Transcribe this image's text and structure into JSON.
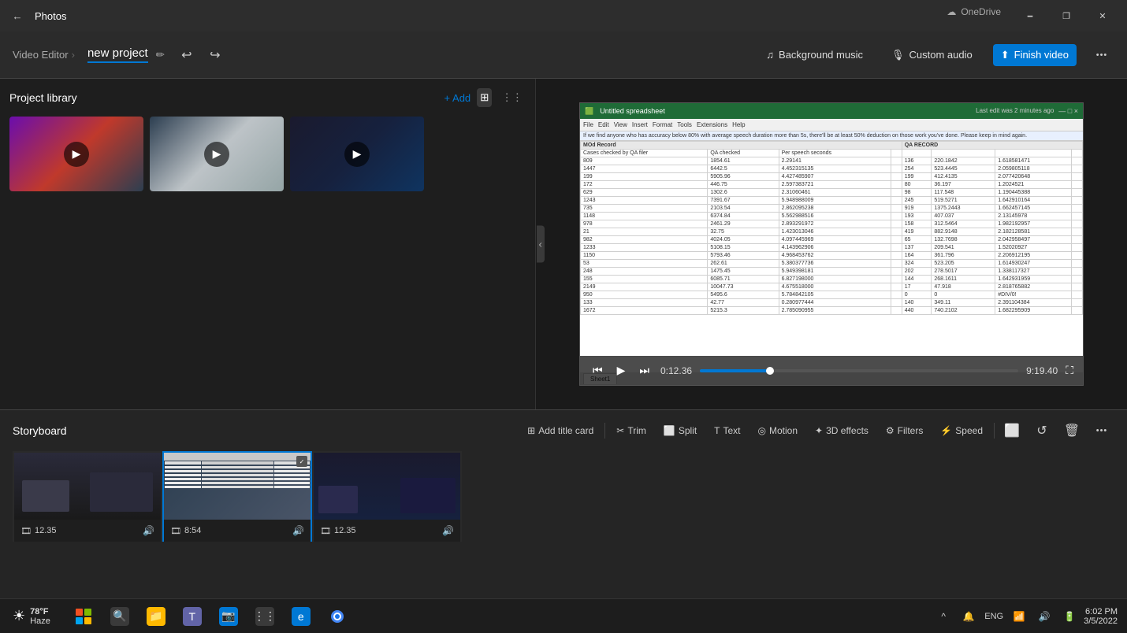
{
  "titlebar": {
    "app_name": "Photos",
    "back_label": "←",
    "onedrive_label": "OneDrive",
    "minimize": "🗕",
    "restore": "❐",
    "close": "✕"
  },
  "toolbar": {
    "breadcrumb_separator": "›",
    "video_editor_label": "Video Editor",
    "project_title": "new project",
    "edit_icon": "✏",
    "undo_icon": "↩",
    "redo_icon": "↪",
    "background_music_label": "Background music",
    "custom_audio_label": "Custom audio",
    "finish_video_label": "Finish video",
    "more_icon": "•••"
  },
  "project_library": {
    "title": "Project library",
    "add_label": "+ Add",
    "grid_view_label": "⊞",
    "list_view_label": "⋮⋮",
    "media_items": [
      {
        "type": "video",
        "id": 1
      },
      {
        "type": "video",
        "id": 2
      },
      {
        "type": "video",
        "id": 3
      }
    ]
  },
  "video_player": {
    "current_time": "0:12.36",
    "total_time": "9:19.40",
    "rewind_icon": "⏮",
    "play_icon": "▶",
    "forward_icon": "⏭",
    "fullscreen_icon": "⛶",
    "progress_percent": 22
  },
  "storyboard": {
    "title": "Storyboard",
    "tools": [
      {
        "id": "add-title",
        "label": "Add title card",
        "icon": "⊞"
      },
      {
        "id": "trim",
        "label": "Trim",
        "icon": "✂"
      },
      {
        "id": "split",
        "label": "Split",
        "icon": "⬜"
      },
      {
        "id": "text",
        "label": "Text",
        "icon": "T"
      },
      {
        "id": "motion",
        "label": "Motion",
        "icon": "◎"
      },
      {
        "id": "3d-effects",
        "label": "3D effects",
        "icon": "✦"
      },
      {
        "id": "filters",
        "label": "Filters",
        "icon": "⚙"
      },
      {
        "id": "speed",
        "label": "Speed",
        "icon": "⚡"
      }
    ],
    "clips": [
      {
        "id": 1,
        "duration": "12.35",
        "has_audio": true
      },
      {
        "id": 2,
        "duration": "8:54",
        "has_audio": true,
        "selected": true
      },
      {
        "id": 3,
        "duration": "12.35",
        "has_audio": true
      }
    ]
  },
  "taskbar": {
    "weather": {
      "icon": "☀",
      "temp": "78°F",
      "condition": "Haze"
    },
    "clock": {
      "time": "6:02 PM",
      "date": "3/5/2022"
    },
    "language": "ENG",
    "tray_icons": [
      "^",
      "🔔",
      "⌨",
      "🔊",
      "📶",
      "🔋"
    ]
  },
  "spreadsheet": {
    "title": "Untitled spreadsheet",
    "menu_items": [
      "File",
      "Edit",
      "View",
      "Insert",
      "Format",
      "Tools",
      "Extensions",
      "Help"
    ],
    "last_edit": "Last edit was 2 minutes ago",
    "tab_name": "Sheet1",
    "headers": [
      "MOd Record",
      "",
      "",
      "",
      "QA RECORD"
    ],
    "sub_headers": [
      "Cases checked by QA filer",
      "QA checked",
      "Per speech seconds",
      "",
      "",
      "",
      ""
    ],
    "rows": [
      [
        "809",
        "1854.61",
        "2.29141",
        "136",
        "220.1842",
        "1.618581471"
      ],
      [
        "1447",
        "6442.5",
        "4.452315135",
        "254",
        "523.4445",
        "2.059805118"
      ],
      [
        "199",
        "5905.96",
        "4.427485907",
        "199",
        "412.4135",
        "2.077420648"
      ],
      [
        "172",
        "446.75",
        "2.597383721",
        "80",
        "36.197",
        "1.2024521"
      ],
      [
        "629",
        "1302.6",
        "2.31060461",
        "98",
        "117.548",
        "1.190445388"
      ],
      [
        "1243",
        "7391.67",
        "5.948988009",
        "245",
        "519.5271",
        "1.642910164"
      ],
      [
        "735",
        "2103.54",
        "2.862095238",
        "919",
        "1375.2443",
        "1.662457145"
      ],
      [
        "1148",
        "6374.84",
        "5.562988516",
        "193",
        "407.037",
        "2.13145978"
      ],
      [
        "978",
        "2461.29",
        "2.893291972",
        "158",
        "312.5464",
        "1.982192957"
      ],
      [
        "21",
        "32.75",
        "1.423013046",
        "419",
        "882.9148",
        "2.182128581"
      ],
      [
        "982",
        "4024.05",
        "4.097445969",
        "65",
        "132.7698",
        "2.042958497"
      ],
      [
        "1233",
        "5108.15",
        "4.143962906",
        "137",
        "209.541",
        "1.52020927"
      ],
      [
        "1150",
        "5793.46",
        "4.968453762",
        "164",
        "361.796",
        "2.206912195"
      ],
      [
        "53",
        "262.61",
        "5.380377736",
        "324",
        "523.205",
        "1.614930247"
      ],
      [
        "248",
        "1475.45",
        "5.949398181",
        "202",
        "278.5017",
        "1.338117327"
      ],
      [
        "155",
        "6085.71",
        "6.827198000",
        "144",
        "268.1611",
        "1.642931959"
      ],
      [
        "2149",
        "10047.73",
        "4.675518000",
        "17",
        "47.918",
        "2.818765882"
      ],
      [
        "950",
        "5495.6",
        "5.784842105",
        "0",
        "0",
        "#DIV/0!"
      ],
      [
        "133",
        "42.77",
        "0.280977444",
        "140",
        "349.11",
        "2.391104384"
      ],
      [
        "1672",
        "5215.3",
        "2.785090955",
        "440",
        "740.2102",
        "1.682295909"
      ]
    ]
  }
}
